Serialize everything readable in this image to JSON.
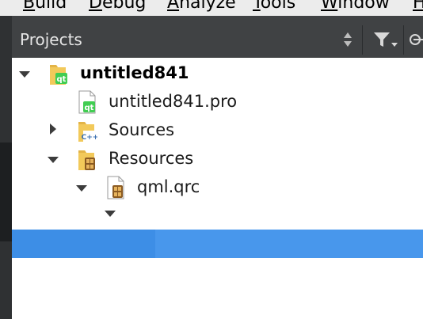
{
  "menubar": {
    "items": [
      {
        "underline": "B",
        "rest": "uild"
      },
      {
        "underline": "D",
        "rest": "ebug"
      },
      {
        "underline": "A",
        "rest": "nalyze"
      },
      {
        "underline": "T",
        "rest": "ools"
      },
      {
        "underline": "W",
        "rest": "indow"
      },
      {
        "underline": "H",
        "rest": ""
      }
    ]
  },
  "panel": {
    "title": "Projects",
    "sort_icon": "up-down-arrows-icon",
    "filter_icon": "filter-icon",
    "link_icon": "link-icon"
  },
  "tree": {
    "project": {
      "label": "untitled841",
      "expanded": true,
      "icon": "qt-project-folder-icon"
    },
    "pro_file": {
      "label": "untitled841.pro",
      "icon": "qt-file-icon"
    },
    "sources": {
      "label": "Sources",
      "expanded": false,
      "icon": "cpp-folder-icon"
    },
    "resources": {
      "label": "Resources",
      "expanded": true,
      "icon": "resource-folder-icon"
    },
    "qrc_file": {
      "label": "qml.qrc",
      "expanded": true,
      "icon": "qrc-file-icon"
    }
  },
  "colors": {
    "accent_selection": "#3d8ee6",
    "panel_bg": "#404244",
    "qt_green": "#41cd52"
  }
}
